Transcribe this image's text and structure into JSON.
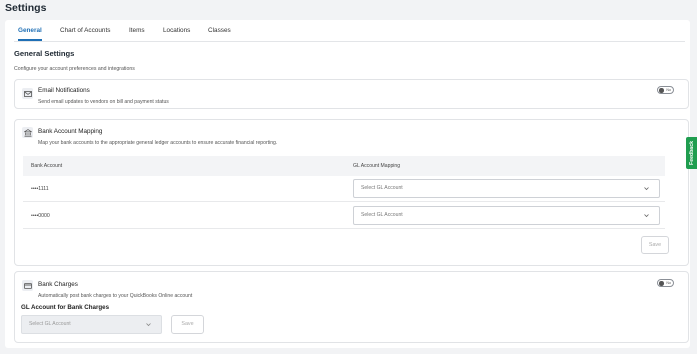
{
  "page": {
    "title": "Settings"
  },
  "tabs": [
    {
      "label": "General",
      "active": true
    },
    {
      "label": "Chart of Accounts",
      "active": false
    },
    {
      "label": "Items",
      "active": false
    },
    {
      "label": "Locations",
      "active": false
    },
    {
      "label": "Classes",
      "active": false
    }
  ],
  "general": {
    "title": "General Settings",
    "subtitle": "Configure your account preferences and integrations"
  },
  "email_notifications": {
    "icon": "mail-icon",
    "title": "Email Notifications",
    "description": "Send email updates to vendors on bill and payment status",
    "toggle_label": "No",
    "enabled": false
  },
  "bank_mapping": {
    "icon": "bank-icon",
    "title": "Bank Account Mapping",
    "description": "Map your bank accounts to the appropriate general ledger accounts to ensure accurate financial reporting.",
    "columns": [
      "Bank Account",
      "GL Account Mapping"
    ],
    "rows": [
      {
        "account": "••••1111",
        "gl_placeholder": "Select GL Account"
      },
      {
        "account": "••••0000",
        "gl_placeholder": "Select GL Account"
      }
    ],
    "save_label": "Save"
  },
  "bank_charges": {
    "icon": "credit-card-icon",
    "title": "Bank Charges",
    "description": "Automatically post bank charges to your QuickBooks Online account",
    "toggle_label": "No",
    "enabled": false,
    "gl_label": "GL Account for Bank Charges",
    "gl_placeholder": "Select GL Account",
    "save_label": "Save"
  },
  "feedback": {
    "label": "Feedback"
  },
  "colors": {
    "accent": "#1f6fb5",
    "feedback": "#1f9d4f"
  }
}
